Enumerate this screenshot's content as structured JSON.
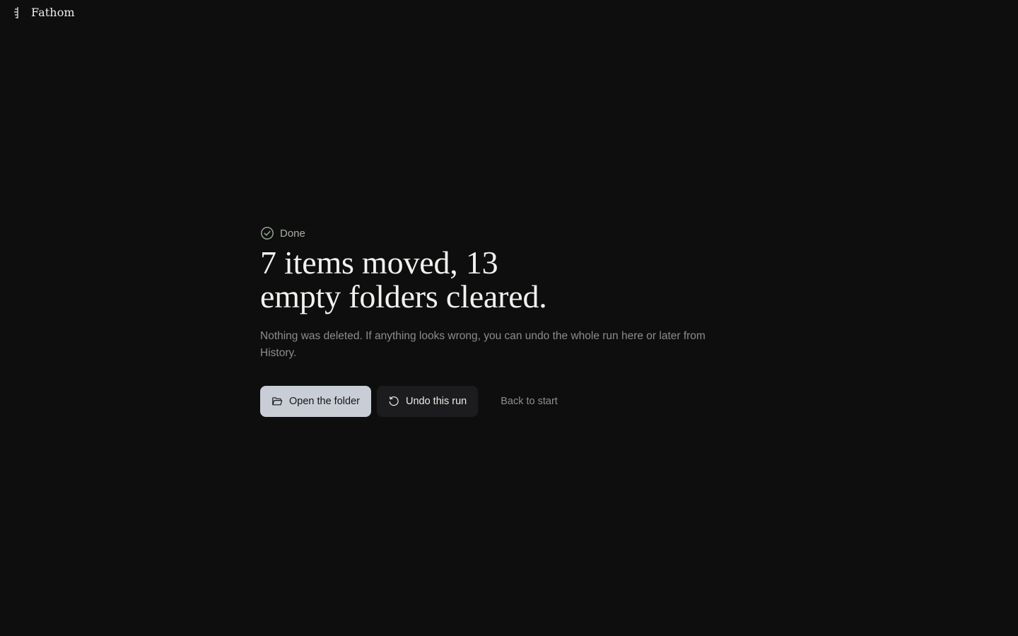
{
  "app": {
    "name": "Fathom",
    "logo_icon": "fathom-logo-icon"
  },
  "status": {
    "label": "Done",
    "icon": "check-circle-icon",
    "color": "#8fa48b"
  },
  "headline": {
    "line1": "7 items moved, 13",
    "line2": "empty folders cleared."
  },
  "summary": "Nothing was deleted. If anything looks wrong, you can undo the whole run here or later from History.",
  "actions": {
    "open_folder": {
      "label": "Open the folder",
      "icon": "folder-open-icon"
    },
    "undo_run": {
      "label": "Undo this run",
      "icon": "undo-icon"
    },
    "back_to_start": {
      "label": "Back to start"
    }
  },
  "colors": {
    "background": "#0e0e0f",
    "primary_button": "#c9cdd6",
    "secondary_button": "#1c1c1e"
  }
}
